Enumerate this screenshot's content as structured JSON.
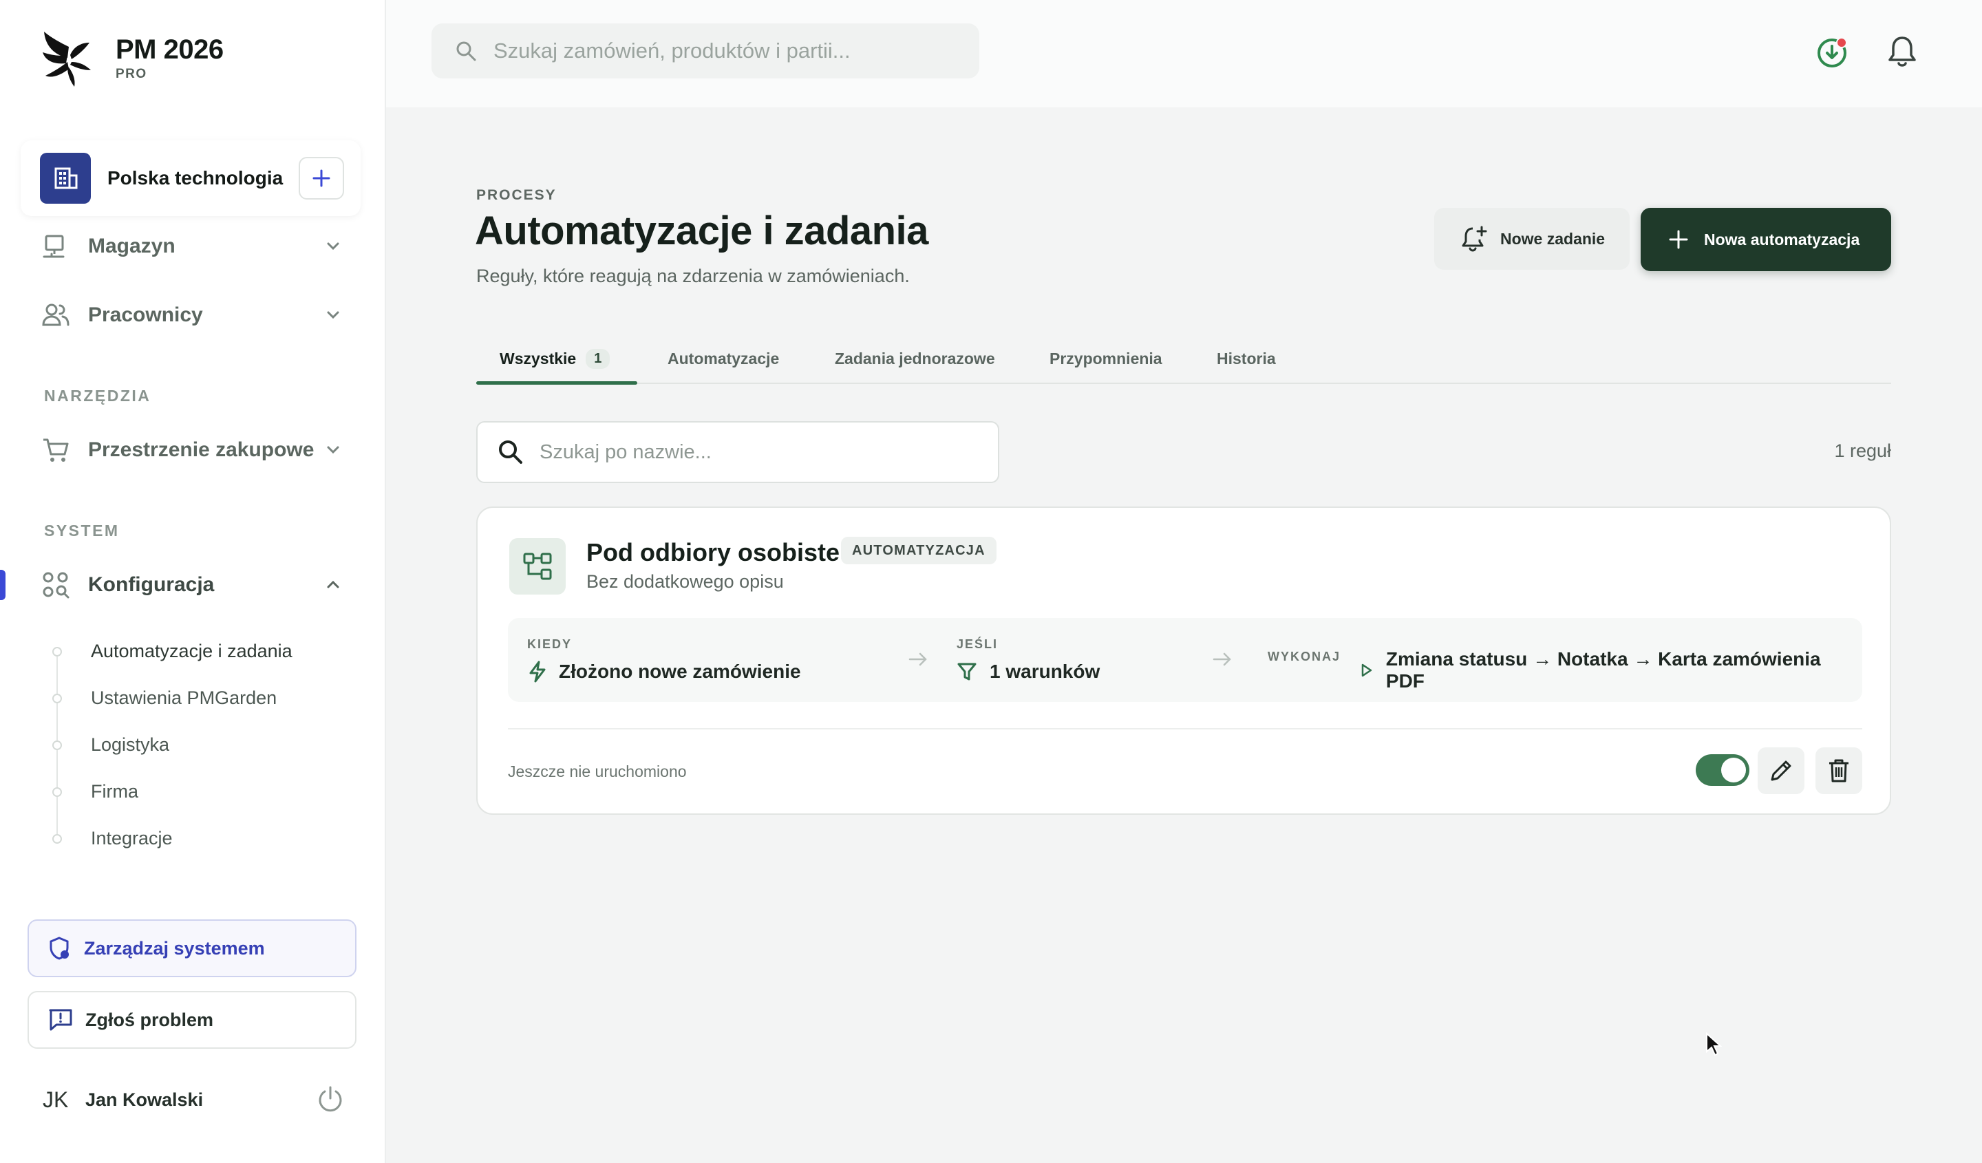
{
  "brand": {
    "name": "PM 2026",
    "tier": "PRO"
  },
  "organization": {
    "name": "Polska technologia"
  },
  "sidebar": {
    "nav": [
      {
        "label": "Magazyn",
        "icon": "warehouse-icon"
      },
      {
        "label": "Pracownicy",
        "icon": "users-icon"
      }
    ],
    "sections": {
      "tools": "NARZĘDZIA",
      "system": "SYSTEM"
    },
    "tools_items": [
      {
        "label": "Przestrzenie zakupowe",
        "icon": "cart-icon"
      }
    ],
    "system_items": [
      {
        "label": "Konfiguracja",
        "icon": "grid-search-icon",
        "expanded": true
      }
    ],
    "subnav": [
      {
        "label": "Automatyzacje i zadania",
        "current": true
      },
      {
        "label": "Ustawienia PMGarden"
      },
      {
        "label": "Logistyka"
      },
      {
        "label": "Firma"
      },
      {
        "label": "Integracje"
      }
    ],
    "manage_label": "Zarządzaj systemem",
    "report_label": "Zgłoś problem"
  },
  "user": {
    "initials": "JK",
    "name": "Jan Kowalski"
  },
  "topbar": {
    "search_placeholder": "Szukaj zamówień, produktów i partii..."
  },
  "page": {
    "eyebrow": "PROCESY",
    "title": "Automatyzacje i zadania",
    "subtitle": "Reguły, które reagują na zdarzenia w zamówieniach.",
    "new_task_label": "Nowe zadanie",
    "new_automation_label": "Nowa automatyzacja"
  },
  "tabs": [
    {
      "label": "Wszystkie",
      "count": "1",
      "active": true
    },
    {
      "label": "Automatyzacje"
    },
    {
      "label": "Zadania jednorazowe"
    },
    {
      "label": "Przypomnienia"
    },
    {
      "label": "Historia"
    }
  ],
  "filter": {
    "placeholder": "Szukaj po nazwie...",
    "rule_count": "1 reguł"
  },
  "rules": [
    {
      "title": "Pod odbiory osobiste",
      "tag": "AUTOMATYZACJA",
      "description": "Bez dodatkowego opisu",
      "when_label": "KIEDY",
      "when_value": "Złożono nowe zamówienie",
      "if_label": "JEŚLI",
      "if_value": "1 warunków",
      "do_label": "WYKONAJ",
      "do_value": "Zmiana statusu → Notatka → Karta zamówienia PDF",
      "status": "Jeszcze nie uruchomiono",
      "enabled": true
    }
  ],
  "colors": {
    "accent_green": "#1f3a2a",
    "toggle_green": "#3d7a53",
    "active_indicator": "#3b49d6",
    "org_badge": "#2d3e8e"
  }
}
